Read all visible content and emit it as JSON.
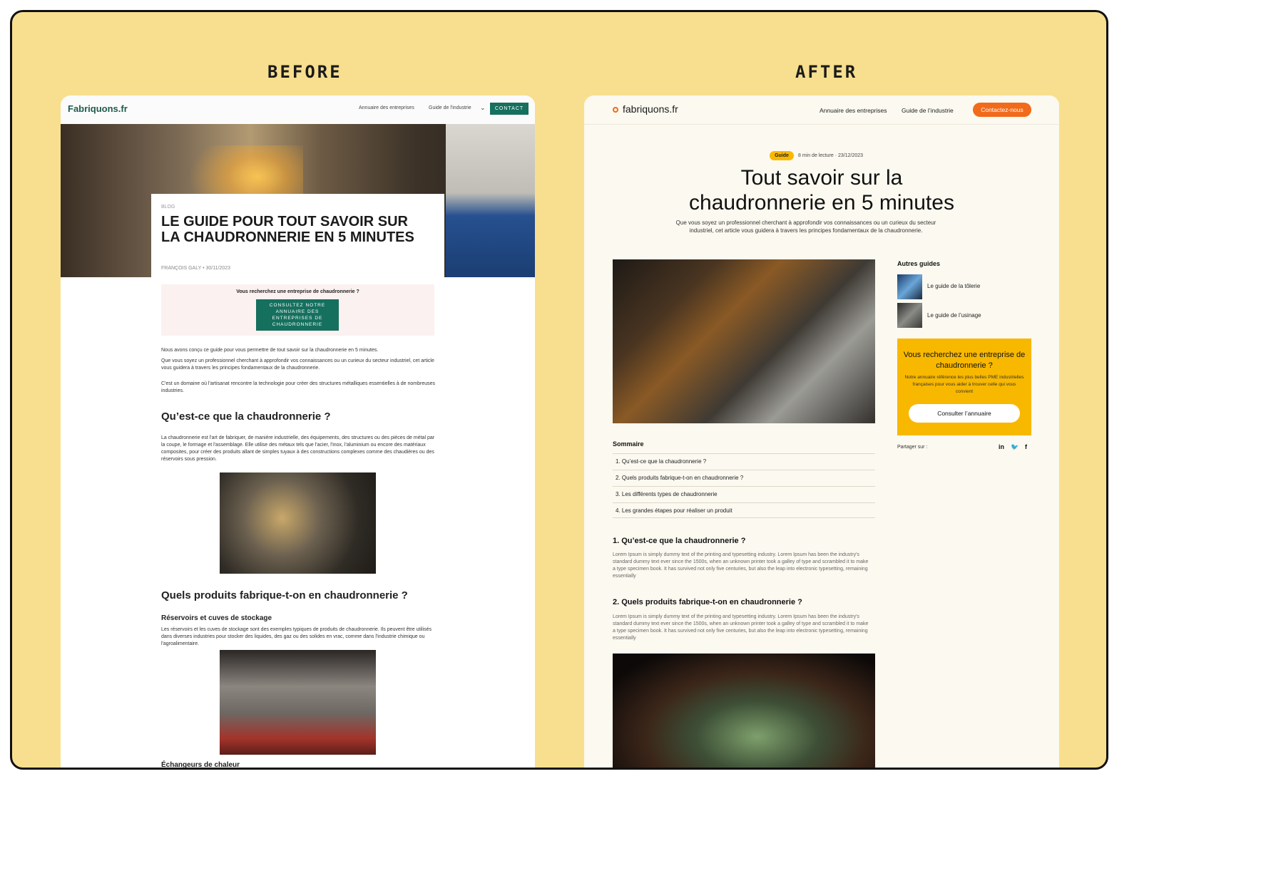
{
  "labels": {
    "before": "BEFORE",
    "after": "AFTER"
  },
  "before": {
    "nav": {
      "logo_name": "Fabriquons",
      "logo_tld": ".fr",
      "links": [
        "Annuaire des entreprises",
        "Guide de l'industrie"
      ],
      "dropdown_icon": "⌄",
      "contact_label": "CONTACT"
    },
    "article": {
      "category": "BLOG",
      "title": "LE GUIDE POUR TOUT SAVOIR SUR LA CHAUDRONNERIE EN 5 MINUTES",
      "author": "FRANÇOIS GALY",
      "separator": "•",
      "date": "30/11/2023",
      "cta_text": "Vous recherchez une entreprise de chaudronnerie ?",
      "cta_button": "CONSULTEZ NOTRE ANNUAIRE DES ENTREPRISES DE CHAUDRONNERIE",
      "p1": "Nous avons conçu ce guide pour vous permettre de tout savoir sur la chaudronnerie en 5 minutes.",
      "p2": "Que vous soyez un professionnel cherchant à approfondir vos connaissances ou un curieux du secteur industriel, cet article vous guidera à travers les principes fondamentaux de la chaudronnerie.",
      "p3": "C'est un domaine où l'artisanat rencontre la technologie pour créer des structures métalliques essentielles à de nombreuses industries.",
      "h2_1": "Qu’est-ce que la chaudronnerie ?",
      "p4": "La chaudronnerie est l'art de fabriquer, de manière industrielle, des équipements, des structures ou des pièces de métal par la coupe, le formage et l'assemblage. Elle utilise des métaux tels que l'acier, l'inox, l'aluminium ou encore des matériaux composites, pour créer des produits allant de simples tuyaux à des constructions complexes comme des chaudières ou des réservoirs sous pression.",
      "h2_2": "Quels produits fabrique-t-on en chaudronnerie ?",
      "h3_1": "Réservoirs et cuves de stockage",
      "p5": "Les réservoirs et les cuves de stockage sont des exemples typiques de produits de chaudronnerie. Ils peuvent être utilisés dans diverses industries pour stocker des liquides, des gaz ou des solides en vrac, comme dans l'industrie chimique ou l'agroalimentaire.",
      "h3_2": "Échangeurs de chaleur"
    }
  },
  "after": {
    "nav": {
      "logo": "fabriquons.fr",
      "links": [
        "Annuaire des entreprises",
        "Guide de l’industrie"
      ],
      "contact_label": "Contactez-nous"
    },
    "badge": "Guide",
    "meta": "8 min de lecture · 23/12/2023",
    "title_line1": "Tout savoir sur la",
    "title_line2": "chaudronnerie en 5 minutes",
    "lede": "Que vous soyez un professionnel cherchant à approfondir vos connaissances ou un curieux du secteur industriel, cet article vous guidera à travers les principes fondamentaux de la chaudronnerie.",
    "sommaire_title": "Sommaire",
    "toc": [
      "1. Qu’est-ce que la chaudronnerie ?",
      "2. Quels produits fabrique-t-on en chaudronnerie ?",
      "3. Les différents types de chaudronnerie",
      "4. Les grandes étapes pour réaliser un produit"
    ],
    "section1_title": "1. Qu’est-ce que la chaudronnerie ?",
    "section1_text": "Lorem Ipsum is simply dummy text of the printing and typesetting industry. Lorem Ipsum has been the industry's standard dummy text ever since the 1500s, when an unknown printer took a galley of type and scrambled it to make a type specimen book. It has survived not only five centuries, but also the leap into electronic typesetting, remaining essentially",
    "section2_title": "2. Quels produits fabrique-t-on en chaudronnerie ?",
    "section2_text": "Lorem Ipsum is simply dummy text of the printing and typesetting industry. Lorem Ipsum has been the industry's standard dummy text ever since the 1500s, when an unknown printer took a galley of type and scrambled it to make a type specimen book. It has survived not only five centuries, but also the leap into electronic typesetting, remaining essentially",
    "sidebar": {
      "title": "Autres guides",
      "guides": [
        "Le guide de la tôlerie",
        "Le guide de l’usinage"
      ],
      "cta_title": "Vous recherchez une entreprise de chaudronnerie ?",
      "cta_sub": "Notre annuaire référence les plus belles PME industrielles françaises pour vous aider à trouver celle qui vous convient",
      "cta_button": "Consulter l’annuaire",
      "share_label": "Partager sur :",
      "social_icons": [
        "in",
        "🐦",
        "f"
      ]
    },
    "colors": {
      "accent": "#f26a1b",
      "highlight": "#f8b800",
      "background": "#fbf9f0"
    }
  }
}
